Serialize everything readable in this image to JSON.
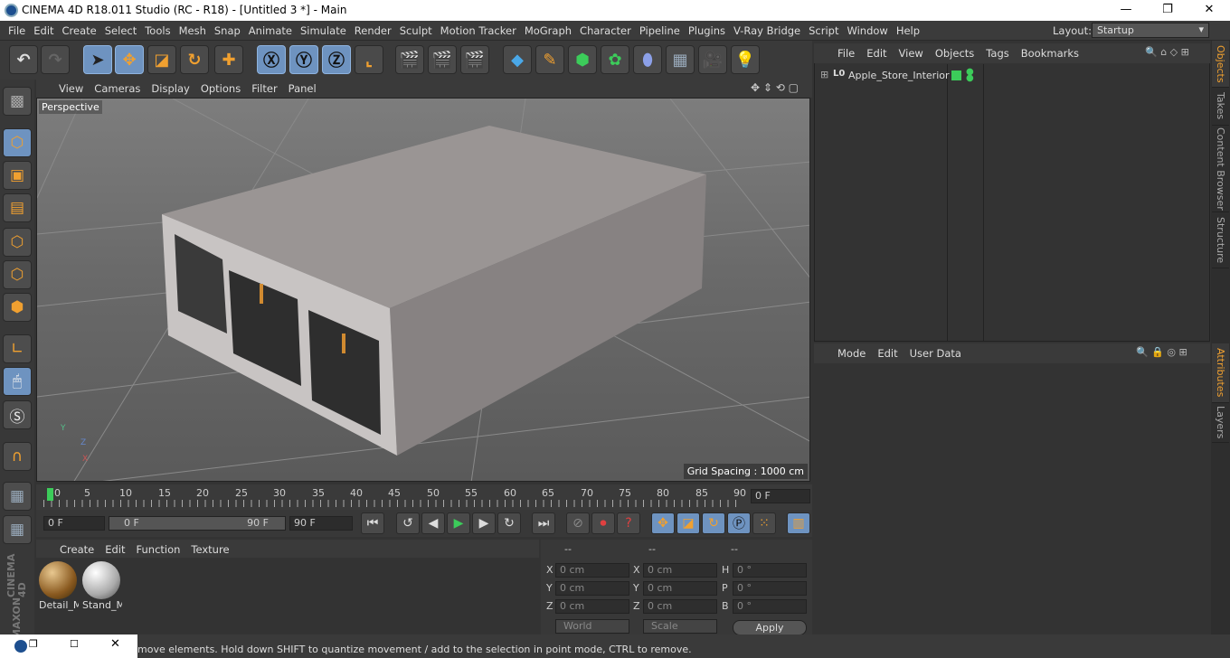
{
  "window": {
    "title": "CINEMA 4D R18.011 Studio (RC - R18) - [Untitled 3 *] - Main",
    "minimize": "—",
    "maximize": "❐",
    "close": "✕"
  },
  "menubar": [
    "File",
    "Edit",
    "Create",
    "Select",
    "Tools",
    "Mesh",
    "Snap",
    "Animate",
    "Simulate",
    "Render",
    "Sculpt",
    "Motion Tracker",
    "MoGraph",
    "Character",
    "Pipeline",
    "Plugins",
    "V-Ray Bridge",
    "Script",
    "Window",
    "Help"
  ],
  "layout": {
    "label": "Layout:",
    "value": "Startup"
  },
  "viewport": {
    "menu": [
      "View",
      "Cameras",
      "Display",
      "Options",
      "Filter",
      "Panel"
    ],
    "label": "Perspective",
    "grid_spacing": "Grid Spacing : 1000 cm",
    "axis": {
      "y": "Y",
      "z": "Z",
      "x": "X"
    }
  },
  "timeline": {
    "ticks": [
      "0",
      "5",
      "10",
      "15",
      "20",
      "25",
      "30",
      "35",
      "40",
      "45",
      "50",
      "55",
      "60",
      "65",
      "70",
      "75",
      "80",
      "85",
      "90"
    ],
    "current_frame": "0 F",
    "start": "0 F",
    "range_start": "0 F",
    "range_end": "90 F",
    "end": "90 F"
  },
  "materials": {
    "menu": [
      "Create",
      "Edit",
      "Function",
      "Texture"
    ],
    "items": [
      {
        "label": "Detail_M"
      },
      {
        "label": "Stand_M"
      }
    ]
  },
  "coords": {
    "headers": [
      "--",
      "--",
      "--"
    ],
    "rows": [
      {
        "l1": "X",
        "v1": "0 cm",
        "l2": "X",
        "v2": "0 cm",
        "l3": "H",
        "v3": "0 °"
      },
      {
        "l1": "Y",
        "v1": "0 cm",
        "l2": "Y",
        "v2": "0 cm",
        "l3": "P",
        "v3": "0 °"
      },
      {
        "l1": "Z",
        "v1": "0 cm",
        "l2": "Z",
        "v2": "0 cm",
        "l3": "B",
        "v3": "0 °"
      }
    ],
    "space": "World",
    "mode": "Scale",
    "apply": "Apply"
  },
  "objects": {
    "menu": [
      "File",
      "Edit",
      "View",
      "Objects",
      "Tags",
      "Bookmarks"
    ],
    "items": [
      {
        "name": "Apple_Store_Interior",
        "badge": "L0"
      }
    ]
  },
  "attributes": {
    "menu": [
      "Mode",
      "Edit",
      "User Data"
    ]
  },
  "right_tabs": [
    "Objects",
    "Takes",
    "Content Browser",
    "Structure",
    "Attributes",
    "Layers"
  ],
  "status": "move elements. Hold down SHIFT to quantize movement / add to the selection in point mode, CTRL to remove.",
  "maxon": {
    "line1": "MAXON",
    "line2": "CINEMA 4D"
  },
  "colors": {
    "accent": "#6e93c0",
    "orange": "#f0a030",
    "green": "#3ccc5a"
  }
}
